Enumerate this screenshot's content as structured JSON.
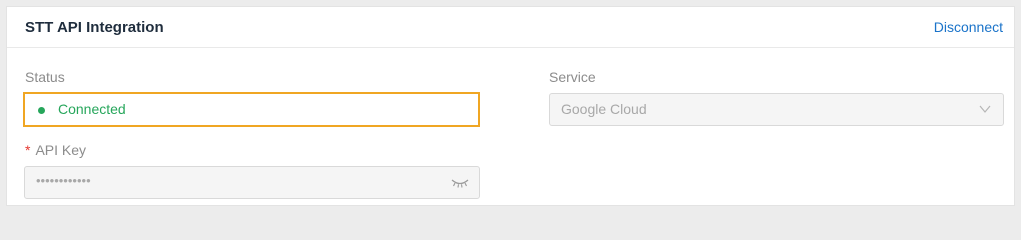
{
  "card": {
    "title": "STT API Integration",
    "disconnect_label": "Disconnect"
  },
  "status": {
    "label": "Status",
    "value": "Connected",
    "color": "#26a65b",
    "highlight_color": "#f0a623"
  },
  "service": {
    "label": "Service",
    "value": "Google Cloud",
    "icon": "chevron-down-icon"
  },
  "api_key": {
    "required_mark": "*",
    "label": "API Key",
    "value": "••••••••••••",
    "icon": "eye-closed-icon"
  },
  "colors": {
    "link": "#1a73c9",
    "required": "#e5362f"
  }
}
